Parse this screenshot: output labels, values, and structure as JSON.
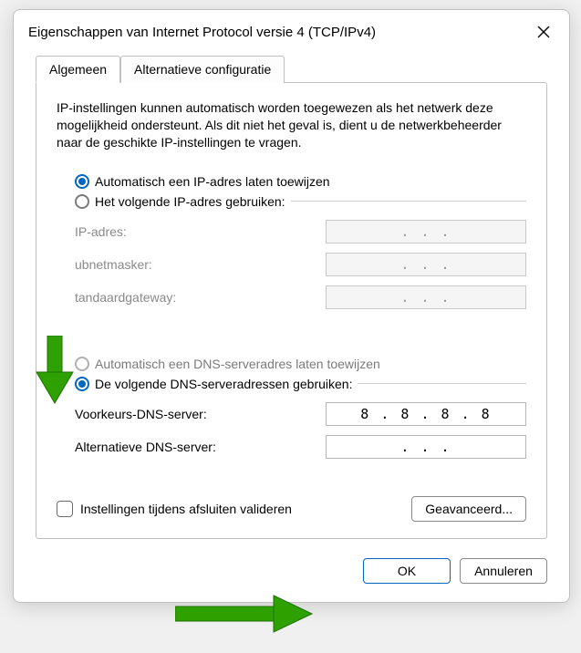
{
  "titlebar": {
    "title": "Eigenschappen van Internet Protocol versie 4 (TCP/IPv4)"
  },
  "tabs": {
    "general": "Algemeen",
    "alternate": "Alternatieve configuratie"
  },
  "intro": "IP-instellingen kunnen automatisch worden toegewezen als het netwerk deze mogelijkheid ondersteunt. Als dit niet het geval is, dient u de netwerkbeheerder naar de geschikte IP-instellingen te vragen.",
  "ip": {
    "auto_label": "Automatisch een IP-adres laten toewijzen",
    "manual_label": "Het volgende IP-adres gebruiken:",
    "address_label": "IP-adres:",
    "address_value": ".   .   .",
    "subnet_label": "ubnetmasker:",
    "subnet_value": ".   .   .",
    "gateway_label": "tandaardgateway:",
    "gateway_value": ".   .   ."
  },
  "dns": {
    "auto_label": "Automatisch een DNS-serveradres laten toewijzen",
    "manual_label": "De volgende DNS-serveradressen gebruiken:",
    "preferred_label": "Voorkeurs-DNS-server:",
    "preferred_value": "8 . 8 . 8 . 8",
    "alternate_label": "Alternatieve DNS-server:",
    "alternate_value": ".   .   ."
  },
  "validate_label": "Instellingen tijdens afsluiten valideren",
  "buttons": {
    "advanced": "Geavanceerd...",
    "ok": "OK",
    "cancel": "Annuleren"
  }
}
